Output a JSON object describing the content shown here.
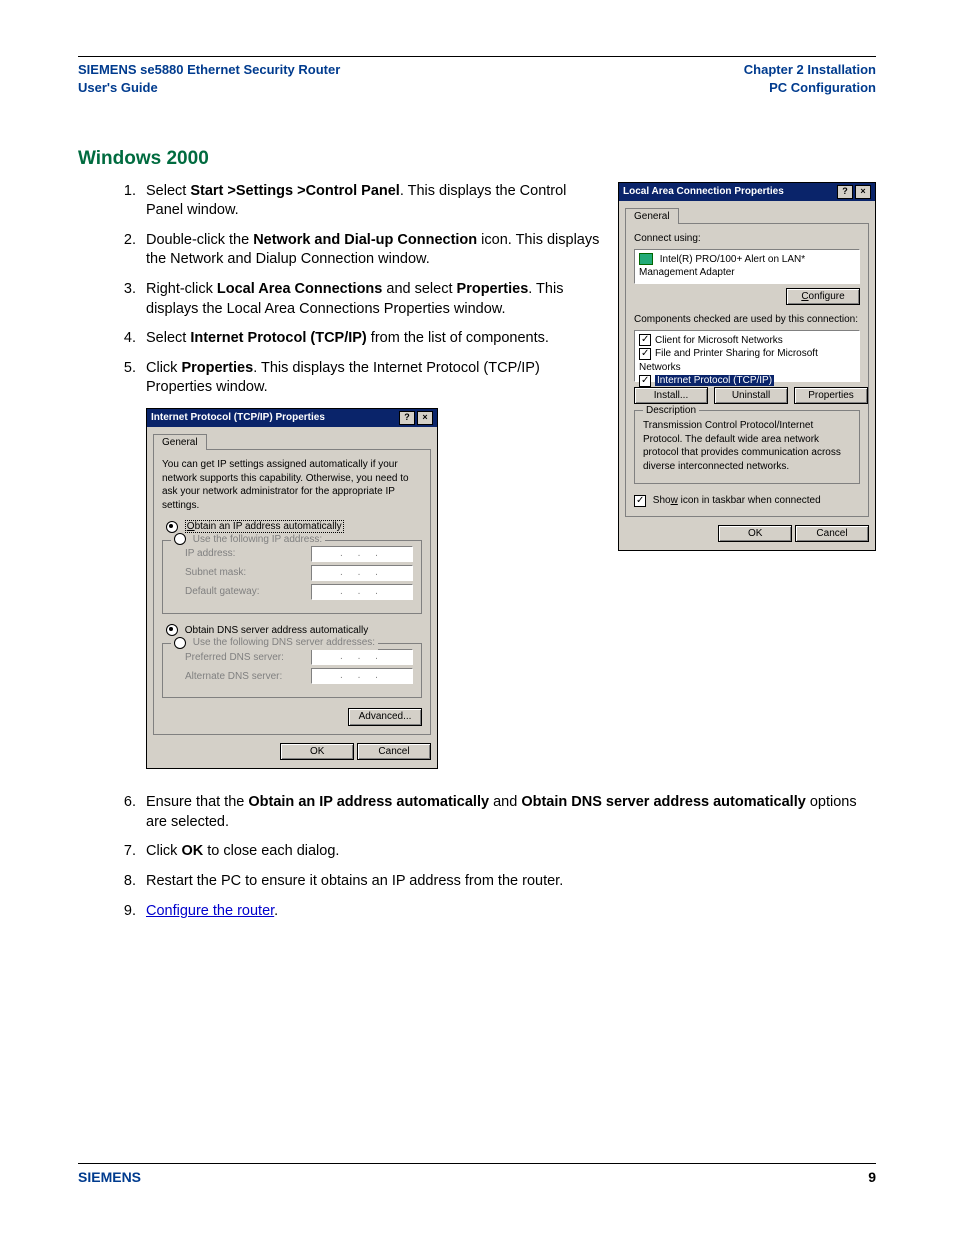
{
  "header": {
    "left1": "SIEMENS se5880 Ethernet Security Router",
    "left2": "User's Guide",
    "right1": "Chapter 2  Installation",
    "right2": "PC Configuration"
  },
  "section_title": "Windows 2000",
  "steps": {
    "s1a": "Select ",
    "s1b": "Start >Settings >Control Panel",
    "s1c": ". This displays the Control Panel window.",
    "s2a": "Double-click the ",
    "s2b": "Network and Dial-up Connection",
    "s2c": " icon. This displays the Network and Dialup Connection window.",
    "s3a": "Right-click ",
    "s3b": "Local Area Connections",
    "s3c": " and select ",
    "s3d": "Properties",
    "s3e": ". This displays the Local Area Connections Properties window.",
    "s4a": "Select ",
    "s4b": "Internet Protocol (TCP/IP)",
    "s4c": " from the list of components.",
    "s5a": " Click ",
    "s5b": "Properties",
    "s5c": ". This displays the Internet Protocol (TCP/IP) Properties window.",
    "s6a": "Ensure that the ",
    "s6b": "Obtain an IP address automatically",
    "s6c": " and ",
    "s6d": "Obtain DNS server address automatically",
    "s6e": " options are selected.",
    "s7a": "Click ",
    "s7b": "OK",
    "s7c": " to close each dialog.",
    "s8": "Restart the PC to ensure it obtains an IP address from the router.",
    "s9_link": "Configure the router",
    "s9_tail": "."
  },
  "dlg_lac": {
    "title": "Local Area Connection Properties",
    "tab": "General",
    "connect_using": "Connect using:",
    "adapter": "Intel(R) PRO/100+ Alert on LAN* Management Adapter",
    "configure": "Configure",
    "components_label": "Components checked are used by this connection:",
    "items": [
      "Client for Microsoft Networks",
      "File and Printer Sharing for Microsoft Networks",
      "Internet Protocol (TCP/IP)"
    ],
    "install": "Install...",
    "uninstall": "Uninstall",
    "properties": "Properties",
    "desc_legend": "Description",
    "desc_text": "Transmission Control Protocol/Internet Protocol. The default wide area network protocol that provides communication across diverse interconnected networks.",
    "show_pre": "Sho",
    "show_u": "w",
    "show_post": " icon in taskbar when connected",
    "ok": "OK",
    "cancel": "Cancel"
  },
  "dlg_ip": {
    "title": "Internet Protocol (TCP/IP) Properties",
    "tab": "General",
    "blurb": "You can get IP settings assigned automatically if your network supports this capability. Otherwise, you need to ask your network administrator for the appropriate IP settings.",
    "opt_auto_ip_u": "O",
    "opt_auto_ip": "btain an IP address automatically",
    "opt_use_ip": "Use the following IP address:",
    "ip_address": "IP address:",
    "subnet": "Subnet mask:",
    "gateway": "Default gateway:",
    "opt_auto_dns": "Obtain DNS server address automatically",
    "opt_use_dns": "Use the following DNS server addresses:",
    "pref_dns": "Preferred DNS server:",
    "alt_dns": "Alternate DNS server:",
    "advanced": "Advanced...",
    "ok": "OK",
    "cancel": "Cancel",
    "dots": ".   .   ."
  },
  "footer": {
    "brand": "SIEMENS",
    "page": "9"
  }
}
